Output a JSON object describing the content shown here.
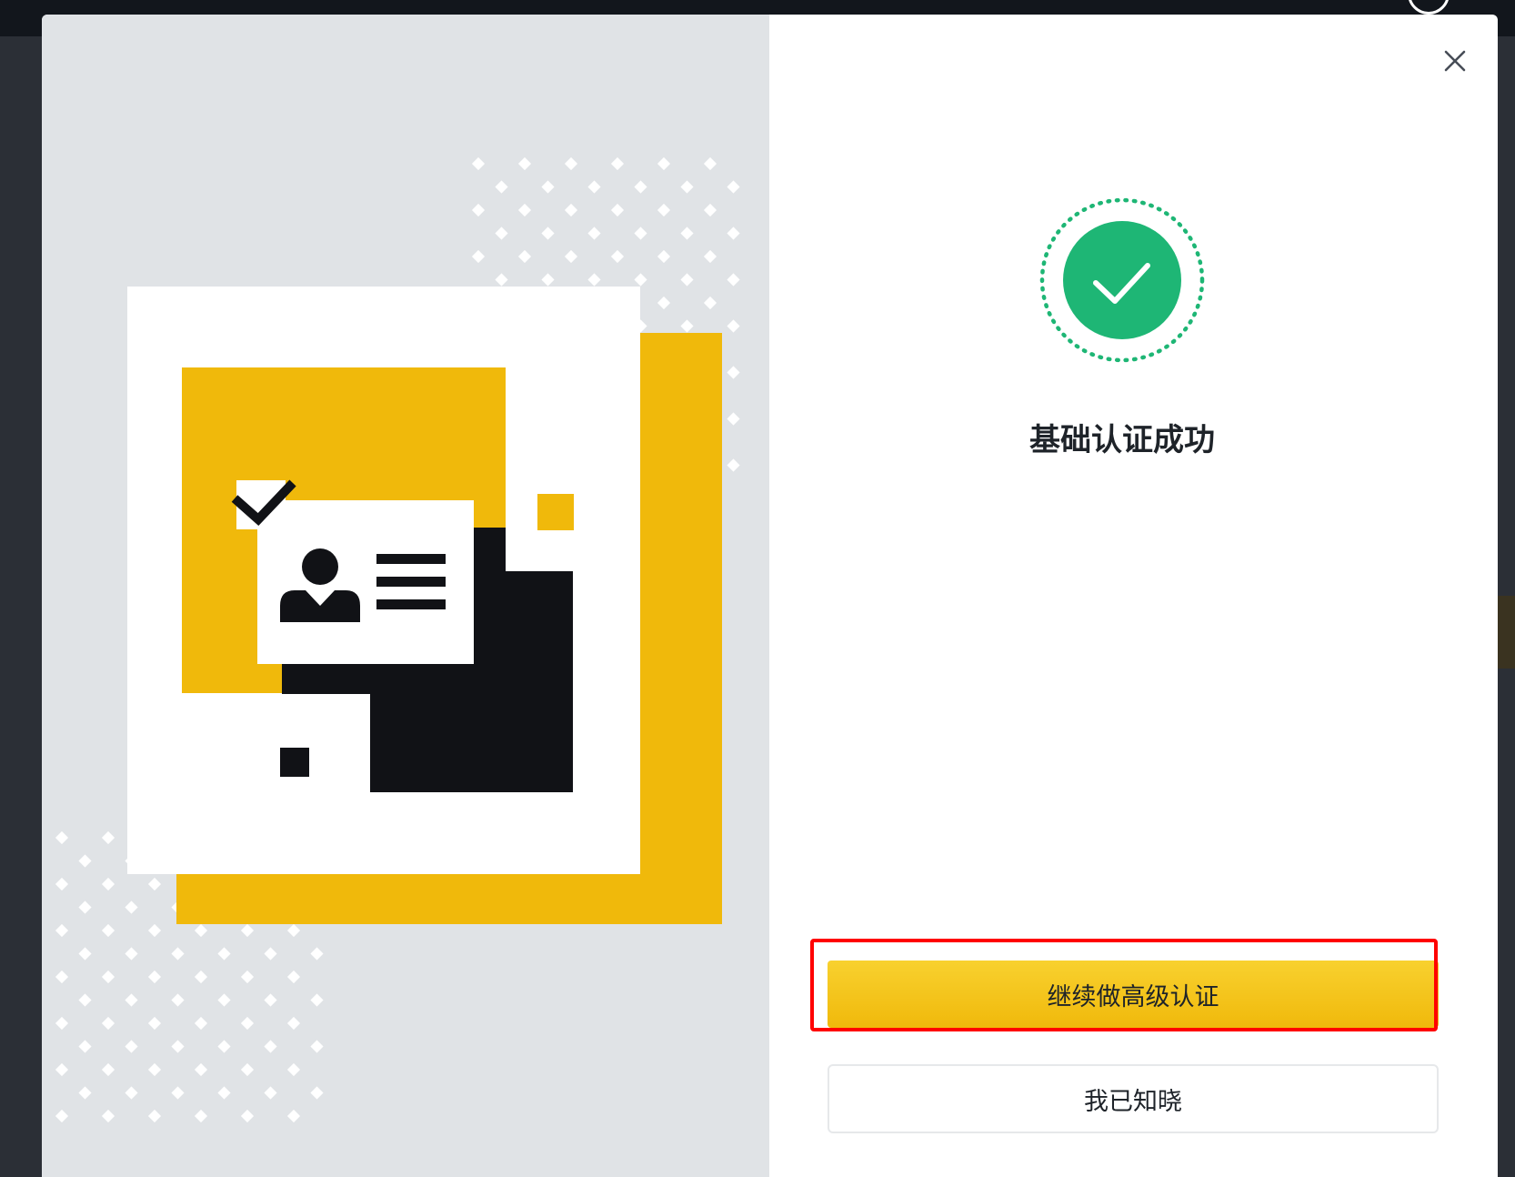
{
  "modal": {
    "close_icon": "close-icon",
    "status_icon": "check-circle-icon",
    "title": "基础认证成功",
    "primary_button_label": "继续做高级认证",
    "secondary_button_label": "我已知晓"
  },
  "colors": {
    "brand_yellow": "#f0b90b",
    "success_green": "#1eb675",
    "dark": "#111216",
    "panel_gray": "#e0e3e6",
    "highlight_red": "#ff0000"
  }
}
